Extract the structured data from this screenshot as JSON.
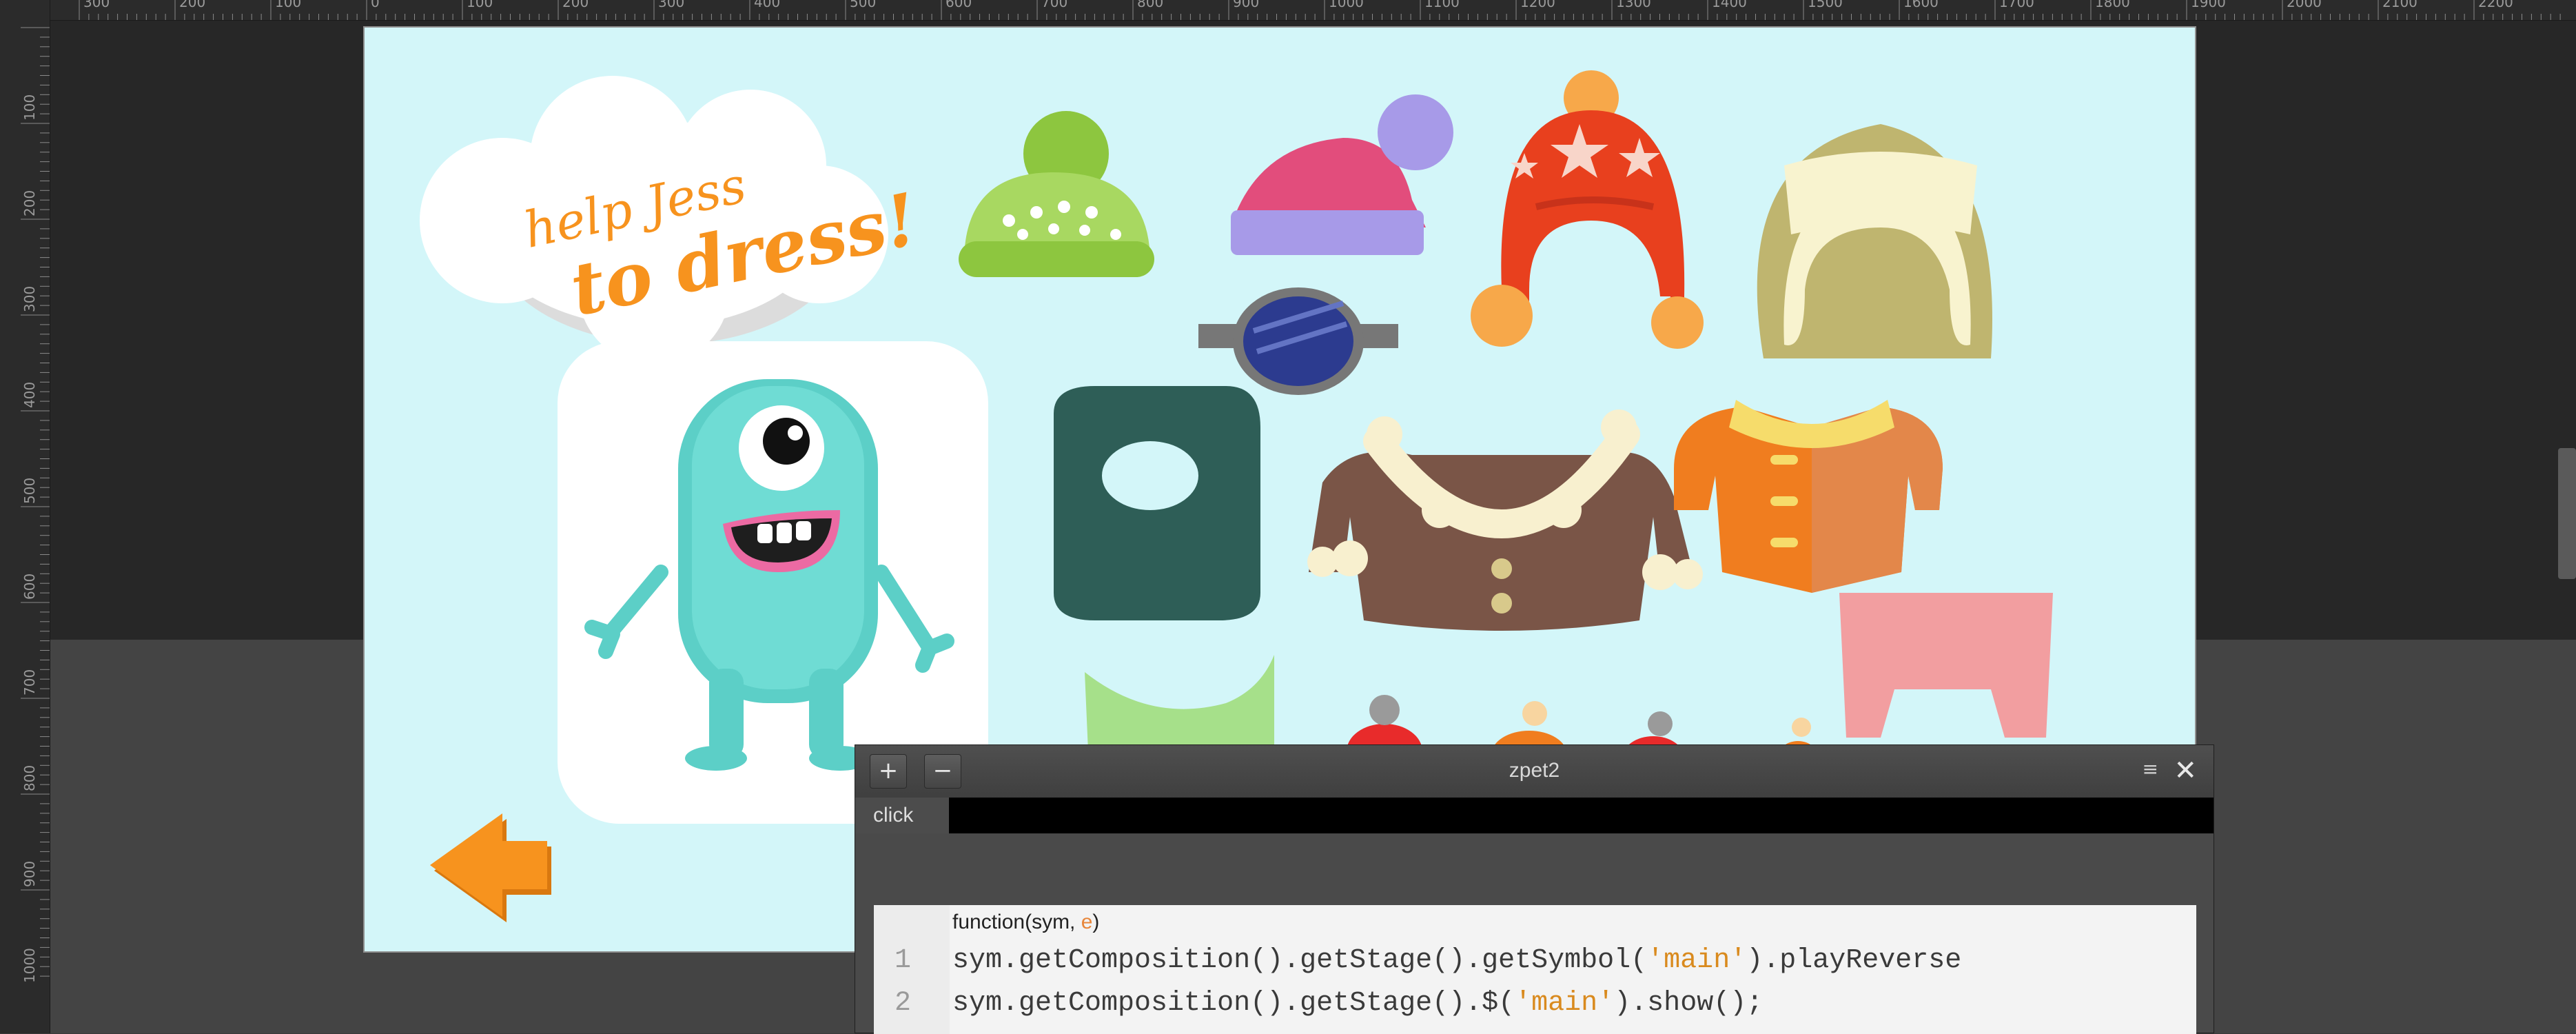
{
  "rulers": {
    "top_ticks": [
      "300",
      "200",
      "100",
      "0",
      "100",
      "200",
      "300",
      "400",
      "500",
      "600",
      "700",
      "800",
      "900",
      "1000",
      "1100",
      "1200",
      "1300",
      "1400",
      "1500",
      "1600",
      "1700",
      "1800",
      "1900",
      "2000",
      "2100",
      "2200"
    ],
    "left_ticks": [
      "100",
      "200",
      "300",
      "400",
      "500",
      "600",
      "700",
      "800",
      "900",
      "1000"
    ]
  },
  "stage": {
    "background": "#d3f6f9",
    "cloud_text_line1": "help Jess",
    "cloud_text_line2": "to dress!",
    "accent_orange": "#f7931e"
  },
  "code_panel": {
    "plus_label": "+",
    "minus_label": "−",
    "title": "zpet2",
    "menu_icon": "≡",
    "close_label": "✕",
    "tab_label": "click",
    "signature_prefix": "function(sym, ",
    "signature_param": "e",
    "signature_suffix": ")",
    "lines": [
      {
        "number": "1",
        "before": "sym.getComposition().getStage().getSymbol(",
        "string": "'main'",
        "after": ").playReverse"
      },
      {
        "number": "2",
        "before": "sym.getComposition().getStage().$(",
        "string": "'main'",
        "after": ").show();"
      }
    ]
  },
  "icons": {
    "arrow": "back-arrow-icon",
    "close": "close-icon",
    "menu": "panel-menu-icon"
  }
}
